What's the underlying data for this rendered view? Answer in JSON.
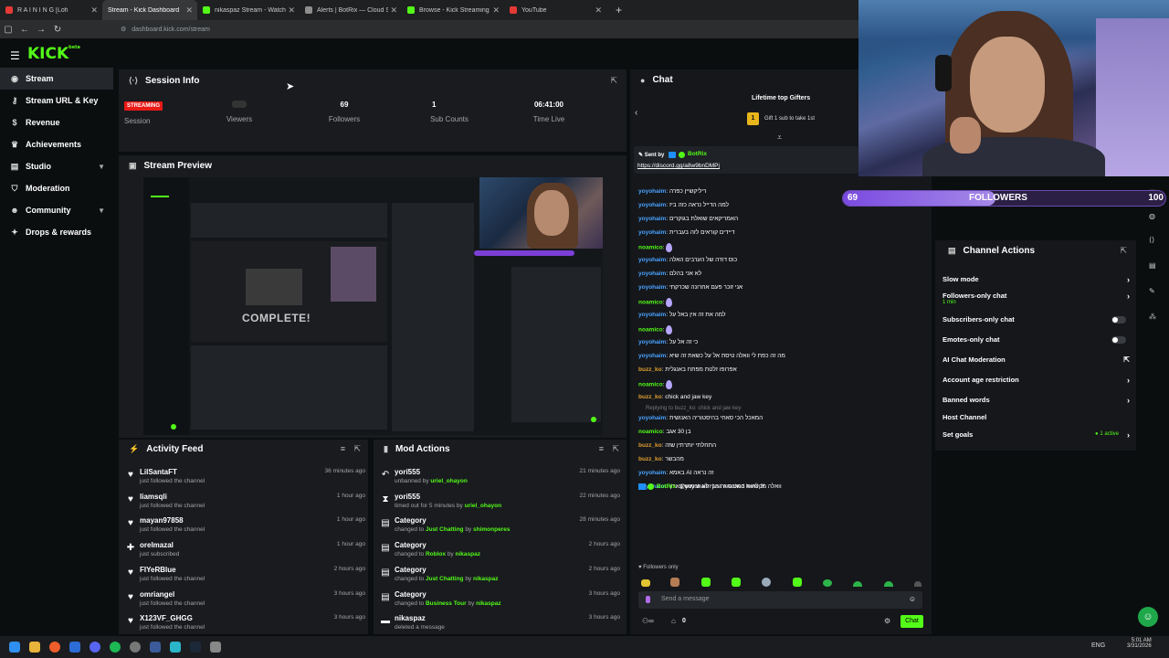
{
  "browser": {
    "tabs": [
      {
        "label": "R A I N I N G [Lofi",
        "color": "#e53935"
      },
      {
        "label": "Stream - Kick Dashboard",
        "color": "#53fc18"
      },
      {
        "label": "nikaspaz Stream - Watch Live",
        "color": "#53fc18"
      },
      {
        "label": "Alerts | BotRix — Cloud Stream",
        "color": "#8e8e8e"
      },
      {
        "label": "Browse - Kick Streaming",
        "color": "#53fc18"
      },
      {
        "label": "YouTube",
        "color": "#e53935"
      }
    ],
    "url": "dashboard.kick.com/stream"
  },
  "app": {
    "logo": "KICK",
    "logo_sup": "beta"
  },
  "sidebar": {
    "items": [
      {
        "label": "Stream",
        "icon": "broadcast-icon"
      },
      {
        "label": "Stream URL & Key",
        "icon": "key-icon"
      },
      {
        "label": "Revenue",
        "icon": "dollar-icon"
      },
      {
        "label": "Achievements",
        "icon": "trophy-icon"
      },
      {
        "label": "Studio",
        "icon": "studio-icon"
      },
      {
        "label": "Moderation",
        "icon": "shield-icon"
      },
      {
        "label": "Community",
        "icon": "users-icon"
      },
      {
        "label": "Drops & rewards",
        "icon": "gift-icon"
      }
    ]
  },
  "session": {
    "title": "Session Info",
    "status": "STREAMING",
    "session_label": "Session",
    "viewers_label": "Viewers",
    "followers_value": "69",
    "followers_label": "Followers",
    "subs_value": "1",
    "subs_label": "Sub Counts",
    "time_value": "06:41:00",
    "time_label": "Time Live"
  },
  "preview": {
    "title": "Stream Preview",
    "overlay_text": "COMPLETE!"
  },
  "activity": {
    "title": "Activity Feed",
    "rows": [
      {
        "name": "LilSantaFT",
        "sub": "just followed the channel",
        "time": "36 minutes ago",
        "icon": "heart-icon"
      },
      {
        "name": "liamsqli",
        "sub": "just followed the channel",
        "time": "1 hour ago",
        "icon": "heart-icon"
      },
      {
        "name": "mayan97858",
        "sub": "just followed the channel",
        "time": "1 hour ago",
        "icon": "heart-icon"
      },
      {
        "name": "orelmazal",
        "sub": "just subscribed",
        "time": "1 hour ago",
        "icon": "star-icon"
      },
      {
        "name": "FIYeRBlue",
        "sub": "just followed the channel",
        "time": "2 hours ago",
        "icon": "heart-icon"
      },
      {
        "name": "omriangel",
        "sub": "just followed the channel",
        "time": "3 hours ago",
        "icon": "heart-icon"
      },
      {
        "name": "X123VF_GHGG",
        "sub": "just followed the channel",
        "time": "3 hours ago",
        "icon": "heart-icon"
      }
    ]
  },
  "modactions": {
    "title": "Mod Actions",
    "rows": [
      {
        "name": "yori555",
        "pre": "unbanned by ",
        "who": "uriel_ohayon",
        "mid": "",
        "by": "",
        "time": "21 minutes ago",
        "icon": "undo-icon"
      },
      {
        "name": "yori555",
        "pre": "timed out for 5 minutes by ",
        "who": "uriel_ohayon",
        "mid": "",
        "by": "",
        "time": "22 minutes ago",
        "icon": "hourglass-icon"
      },
      {
        "name": "Category",
        "pre": "changed to ",
        "who": "Just Chatting",
        "mid": " by ",
        "by": "shimonperes",
        "time": "28 minutes ago",
        "icon": "category-icon"
      },
      {
        "name": "Category",
        "pre": "changed to ",
        "who": "Roblox",
        "mid": " by ",
        "by": "nikaspaz",
        "time": "2 hours ago",
        "icon": "category-icon"
      },
      {
        "name": "Category",
        "pre": "changed to ",
        "who": "Just Chatting",
        "mid": " by ",
        "by": "nikaspaz",
        "time": "2 hours ago",
        "icon": "category-icon"
      },
      {
        "name": "Category",
        "pre": "changed to ",
        "who": "Business Tour",
        "mid": " by ",
        "by": "nikaspaz",
        "time": "3 hours ago",
        "icon": "category-icon"
      },
      {
        "name": "nikaspaz",
        "pre": "deleted a message",
        "who": "",
        "mid": "",
        "by": "",
        "time": "3 hours ago",
        "icon": "trash-icon"
      }
    ]
  },
  "chat": {
    "title": "Chat",
    "gifters_title": "Lifetime top Gifters",
    "gifter_text": "Gift 1 sub to take 1st",
    "gifter_rank": "1",
    "pinned_sender_label": "Sent by",
    "pinned_sender": "BotRix",
    "pinned_link": "https://discord.gg/a8w9bnDMPj",
    "messages": [
      {
        "user": "yoyohaim",
        "color": "#4aa3ff",
        "text": "ריליקשיין כפרה"
      },
      {
        "user": "yoyohaim",
        "color": "#4aa3ff",
        "text": "למה הדייל נראה כזה ביז"
      },
      {
        "user": "yoyohaim",
        "color": "#4aa3ff",
        "text": "האמריקאים שואלת בגוקרים"
      },
      {
        "user": "yoyohaim",
        "color": "#4aa3ff",
        "text": "דיידים קוראים לזה בעברית"
      },
      {
        "user": "noamico",
        "color": "#53fc18",
        "text": ""
      },
      {
        "user": "yoyohaim",
        "color": "#4aa3ff",
        "text": "כוס דודה של הערבים האלה"
      },
      {
        "user": "yoyohaim",
        "color": "#4aa3ff",
        "text": "לא אני בהלם"
      },
      {
        "user": "yoyohaim",
        "color": "#4aa3ff",
        "text": "אני זוכר פעם אחרונה שכרקתי"
      },
      {
        "user": "noamico",
        "color": "#53fc18",
        "text": ""
      },
      {
        "user": "yoyohaim",
        "color": "#4aa3ff",
        "text": "למה את זה אין באל על"
      },
      {
        "user": "noamico",
        "color": "#53fc18",
        "text": ""
      },
      {
        "user": "yoyohaim",
        "color": "#4aa3ff",
        "text": "כי זה אל על"
      },
      {
        "user": "yoyohaim",
        "color": "#4aa3ff",
        "text": "מה זה כפת לי וואלה טיסת אל על כשאת זה שיא"
      },
      {
        "user": "buzz_ko",
        "color": "#e0a030",
        "text": "אפרופו זלטת מפתח באנגלית"
      },
      {
        "user": "noamico",
        "color": "#53fc18",
        "text": ""
      },
      {
        "user": "buzz_ko",
        "color": "#e0a030",
        "text": "chick and jaw key"
      },
      {
        "user": "yoyohaim",
        "color": "#4aa3ff",
        "text": "המאכל הכי סאחי בהיסטוריה האנושית"
      },
      {
        "user": "noamico",
        "color": "#53fc18",
        "text": "בן 30 אגב"
      },
      {
        "user": "buzz_ko",
        "color": "#e0a030",
        "text": "התחלתי יותרתין שזה"
      },
      {
        "user": "buzz_ko",
        "color": "#e0a030",
        "text": "מהבשר"
      },
      {
        "user": "yoyohaim",
        "color": "#4aa3ff",
        "text": "באמא AI זה נראה"
      },
      {
        "user": "yoyohaim",
        "color": "#4aa3ff",
        "text": "וואלה מקלחות במטוס זה הכי לא שימוש בארץ"
      },
      {
        "user": "BotRix",
        "color": "#53fc18",
        "text": "@yoyohaim just reached level 2!"
      }
    ],
    "reply_text": "Replying to buzz_ko: chick and jaw key",
    "followers_only": "Followers only",
    "input_placeholder": "Send a message",
    "count": "0",
    "send_label": "Chat"
  },
  "followers_goal": {
    "current": "69",
    "label": "FOLLOWERS",
    "target": "100",
    "fill_percent": 69
  },
  "channel_actions": {
    "title": "Channel Actions",
    "rows": [
      {
        "label": "Slow mode",
        "type": "arrow",
        "sub": ""
      },
      {
        "label": "Followers-only chat",
        "type": "arrow",
        "sub": "1 min"
      },
      {
        "label": "Subscribers-only chat",
        "type": "toggle",
        "sub": ""
      },
      {
        "label": "Emotes-only chat",
        "type": "toggle",
        "sub": ""
      },
      {
        "label": "AI Chat Moderation",
        "type": "external",
        "sub": ""
      },
      {
        "label": "Account age restriction",
        "type": "arrow",
        "sub": ""
      },
      {
        "label": "Banned words",
        "type": "arrow",
        "sub": ""
      },
      {
        "label": "Host Channel",
        "type": "none",
        "sub": ""
      },
      {
        "label": "Set goals",
        "type": "arrow",
        "sub": "",
        "status": "1 active"
      }
    ]
  },
  "taskbar": {
    "time": "5:01 AM",
    "date": "3/31/2026",
    "lang": "ENG"
  }
}
